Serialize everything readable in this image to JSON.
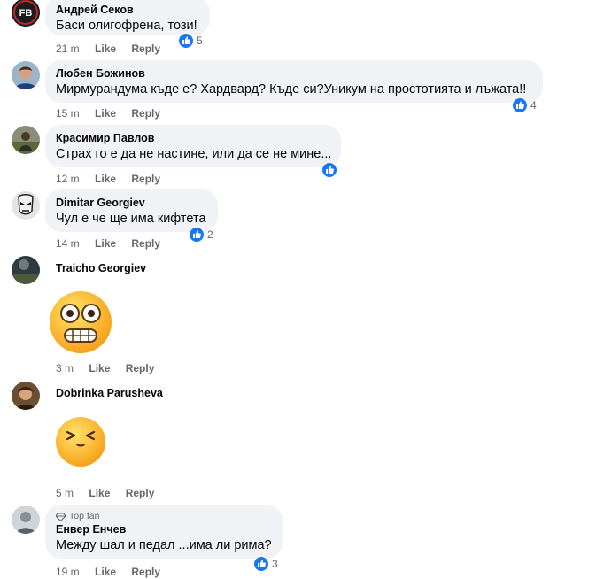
{
  "colors": {
    "bubble": "#f0f2f5",
    "meta": "#65676b",
    "like_blue": "#1877f2"
  },
  "comments": [
    {
      "author": "Андрей Секов",
      "text": "Баси олигофрена, този!",
      "time": "21 m",
      "like": "Like",
      "reply": "Reply",
      "reactions": "5",
      "avatar_label": "FB"
    },
    {
      "author": "Любен Божинов",
      "text": "Мирмурандума къде е? Хардвард? Къде си?Уникум на простотията и лъжата!!",
      "time": "15 m",
      "like": "Like",
      "reply": "Reply",
      "reactions": "4"
    },
    {
      "author": "Красимир Павлов",
      "text": "Страх го е да не настине, или да се не мине...",
      "time": "12 m",
      "like": "Like",
      "reply": "Reply",
      "reactions": ""
    },
    {
      "author": "Dimitar Georgiev",
      "text": "Чул е че ще има кифтета",
      "time": "14 m",
      "like": "Like",
      "reply": "Reply",
      "reactions": "2"
    },
    {
      "author": "Traicho Georgiev",
      "sticker": "grimacing-emoji",
      "time": "3 m",
      "like": "Like",
      "reply": "Reply"
    },
    {
      "author": "Dobrinka Parusheva",
      "sticker": "squinting-emoji",
      "time": "5 m",
      "like": "Like",
      "reply": "Reply"
    },
    {
      "author": "Енвер Енчев",
      "badge": "Top fan",
      "text": "Между шал и педал ...има ли рима?",
      "time": "19 m",
      "like": "Like",
      "reply": "Reply",
      "reactions": "3"
    }
  ]
}
